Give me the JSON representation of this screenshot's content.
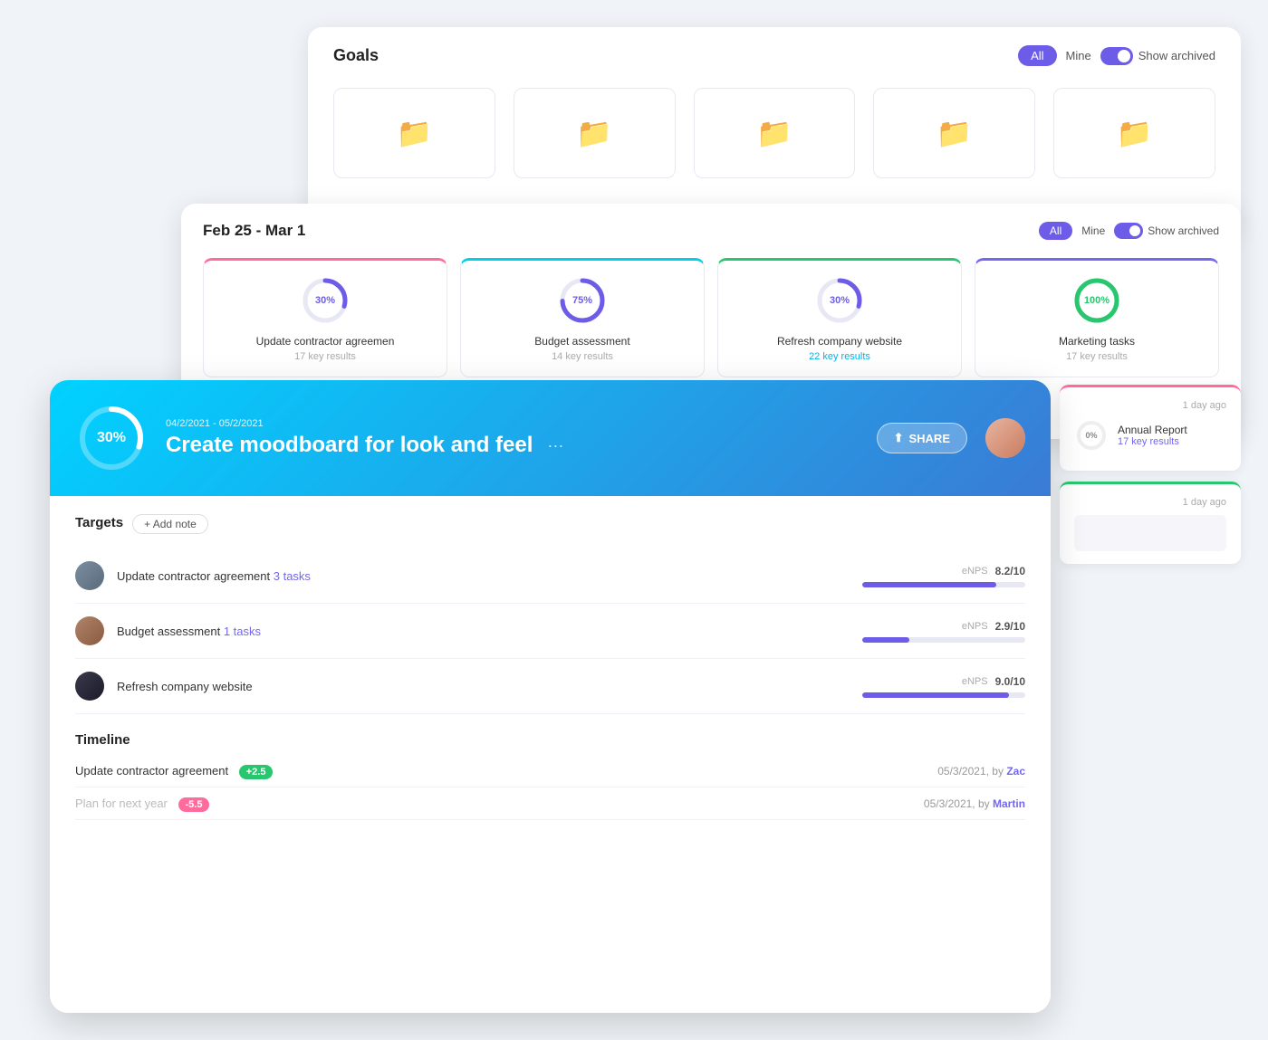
{
  "goals_panel": {
    "title": "Goals",
    "btn_all": "All",
    "btn_mine": "Mine",
    "show_archived": "Show archived",
    "folders": [
      {
        "id": 1
      },
      {
        "id": 2
      },
      {
        "id": 3
      },
      {
        "id": 4
      },
      {
        "id": 5
      }
    ]
  },
  "weekly_panel": {
    "title": "Feb 25 - Mar 1",
    "btn_all": "All",
    "btn_mine": "Mine",
    "show_archived": "Show archived",
    "cards": [
      {
        "id": 1,
        "percent": 30,
        "percent_label": "30%",
        "name": "Update contractor agreemen",
        "sub": "17 key results",
        "color": "pink",
        "ring_color": "#6c5ce7",
        "link_color": false
      },
      {
        "id": 2,
        "percent": 75,
        "percent_label": "75%",
        "name": "Budget assessment",
        "sub": "14 key results",
        "color": "blue",
        "ring_color": "#6c5ce7",
        "link_color": false
      },
      {
        "id": 3,
        "percent": 30,
        "percent_label": "30%",
        "name": "Refresh company website",
        "sub": "22 key results",
        "color": "green",
        "ring_color": "#6c5ce7",
        "link_color": true
      },
      {
        "id": 4,
        "percent": 100,
        "percent_label": "100%",
        "name": "Marketing tasks",
        "sub": "17 key results",
        "color": "purple",
        "ring_color": "#28c76f",
        "link_color": false
      }
    ]
  },
  "right_panel": {
    "card1": {
      "time_ago": "1 day ago",
      "percent": 0,
      "percent_label": "0%",
      "name": "Annual Report",
      "sub": "17 key results",
      "border": "pink"
    },
    "card2": {
      "time_ago": "1 day ago",
      "border": "green"
    }
  },
  "main_card": {
    "date_range": "04/2/2021 - 05/2/2021",
    "percent": 30,
    "percent_label": "30%",
    "title": "Create moodboard for look and feel",
    "share_label": "SHARE",
    "sections": {
      "targets_label": "Targets",
      "add_note_label": "+ Add note",
      "targets": [
        {
          "name": "Update contractor agreement",
          "tasks": "3 tasks",
          "metric_label": "eNPS",
          "metric_value": "8.2/10",
          "bar_pct": 82,
          "avatar": "1"
        },
        {
          "name": "Budget assessment",
          "tasks": "1 tasks",
          "metric_label": "eNPS",
          "metric_value": "2.9/10",
          "bar_pct": 29,
          "avatar": "2"
        },
        {
          "name": "Refresh company website",
          "tasks": "",
          "metric_label": "eNPS",
          "metric_value": "9.0/10",
          "bar_pct": 90,
          "avatar": "3"
        }
      ],
      "timeline_label": "Timeline",
      "timeline": [
        {
          "name": "Update contractor agreement",
          "badge": "+2.5",
          "badge_type": "green",
          "date": "05/3/2021, by",
          "by": "Zac"
        },
        {
          "name": "Plan for next year",
          "badge": "-5.5",
          "badge_type": "red",
          "date": "05/3/2021, by",
          "by": "Martin"
        }
      ]
    }
  }
}
